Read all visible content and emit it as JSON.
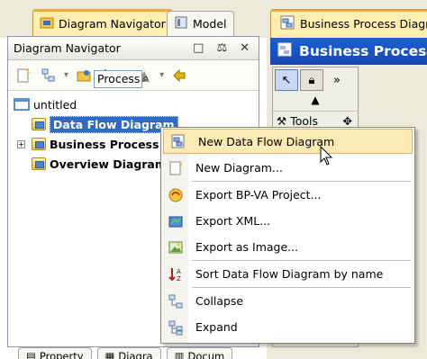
{
  "left_tabs": [
    {
      "label": "Diagram Navigator",
      "icon": "diagram-navigator-icon",
      "active": true
    },
    {
      "label": "Model",
      "icon": "model-icon",
      "active": false
    }
  ],
  "navigator": {
    "title": "Diagram Navigator",
    "controls": [
      "restore-icon",
      "pin-icon",
      "close-icon"
    ],
    "tree": {
      "root": "untitled",
      "items": [
        {
          "label": "Data Flow Diagram",
          "selected": true,
          "expandable": false
        },
        {
          "label": "Business Process",
          "selected": false,
          "expandable": true
        },
        {
          "label": "Overview Diagram",
          "selected": false,
          "expandable": false
        }
      ]
    }
  },
  "bottom_tabs": [
    "Property",
    "Diagra",
    "Docum"
  ],
  "editor": {
    "tab_label": "Business Process Diagram",
    "title": "Business Process D",
    "palette_tools_label": "Tools",
    "process_field": "Process"
  },
  "context_menu": {
    "items": [
      {
        "label": "New Data Flow Diagram",
        "icon": "new-dfd-icon",
        "hover": true
      },
      {
        "label": "New Diagram...",
        "icon": "new-diagram-icon",
        "hover": false
      },
      {
        "separator": true
      },
      {
        "label": "Export BP-VA Project...",
        "icon": "export-bpva-icon",
        "hover": false
      },
      {
        "label": "Export XML...",
        "icon": "export-xml-icon",
        "hover": false
      },
      {
        "label": "Export as Image...",
        "icon": "export-image-icon",
        "hover": false
      },
      {
        "separator": true
      },
      {
        "label": "Sort Data Flow Diagram by name",
        "icon": "sort-az-icon",
        "hover": false
      },
      {
        "separator": true
      },
      {
        "label": "Collapse",
        "icon": "collapse-icon",
        "hover": false
      },
      {
        "label": "Expand",
        "icon": "expand-icon",
        "hover": false
      }
    ]
  },
  "colors": {
    "selection_blue": "#316ac5",
    "menu_hover": "#fce9b3",
    "title_bar_blue": "#1c5fd6",
    "active_tab": "#ffeeb0"
  }
}
